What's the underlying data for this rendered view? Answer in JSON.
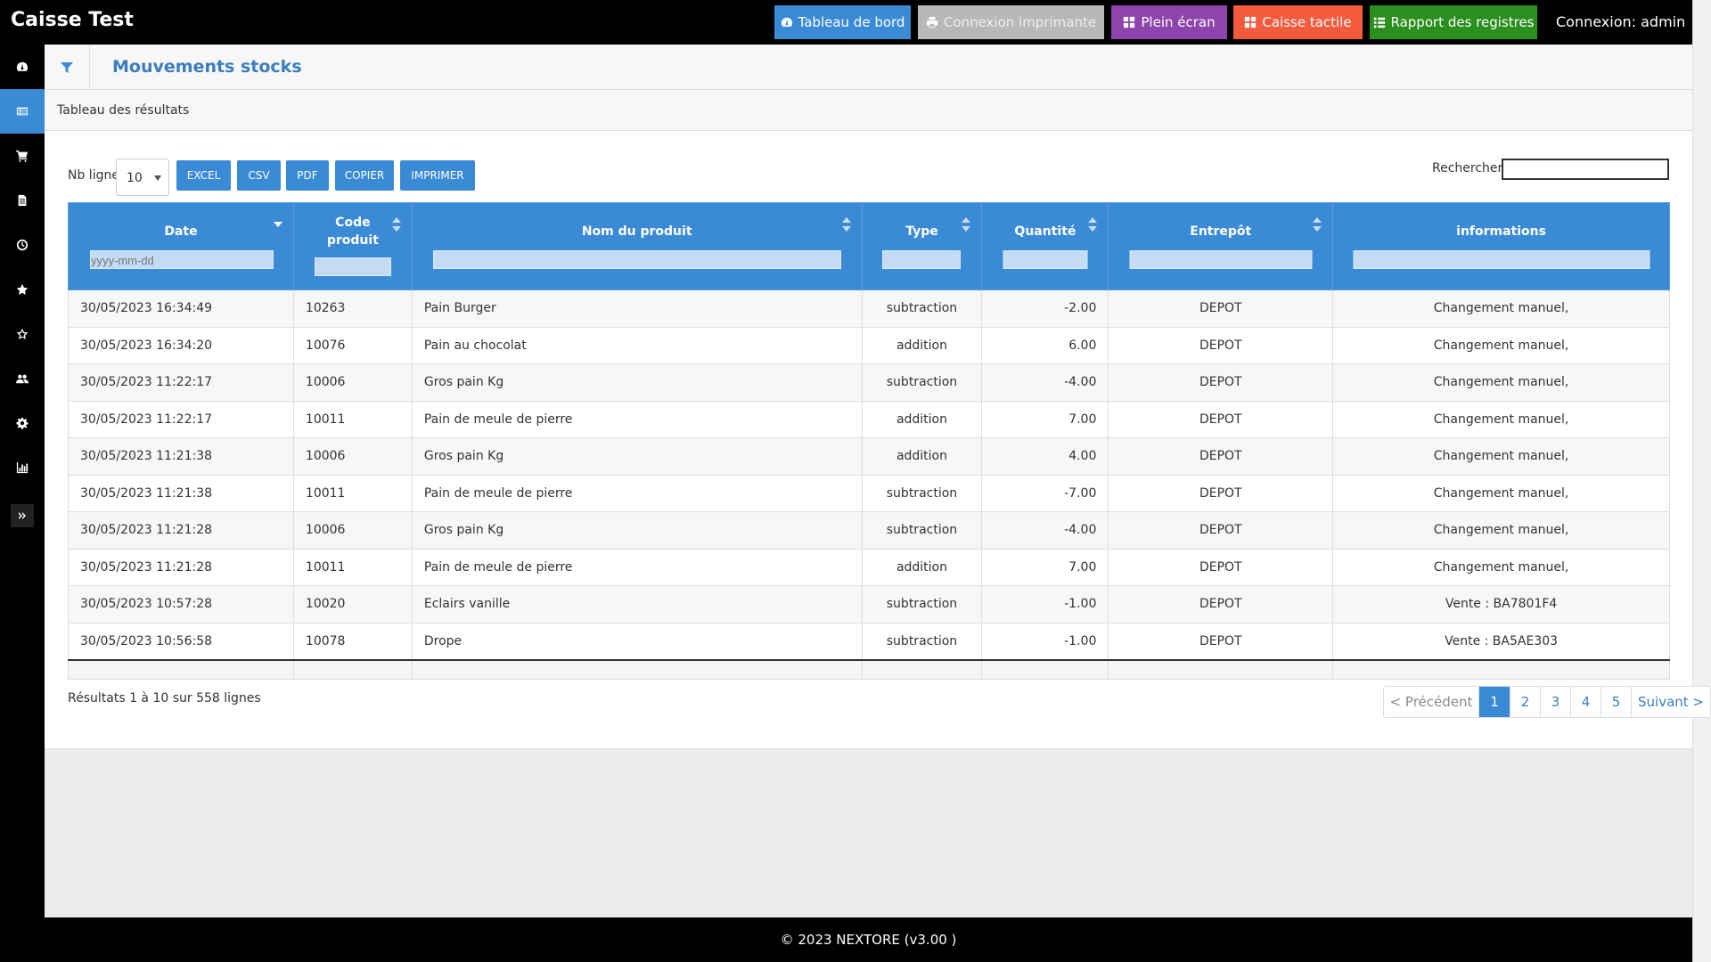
{
  "app": {
    "title": "Caisse Test",
    "login_text": "Connexion: admin"
  },
  "topbar": {
    "dashboard": "Tableau de bord",
    "printer": "Connexion imprimante",
    "fullscreen": "Plein écran",
    "touch": "Caisse tactile",
    "report": "Rapport des registres"
  },
  "colors": {
    "accent": "#3a8ad6",
    "fullscreen": "#8e44ad",
    "touch": "#f25b3c",
    "report": "#2b8f1e",
    "printer": "#b8b8b8"
  },
  "sidebar": {
    "items": [
      "dashboard-icon",
      "table-icon",
      "cart-icon",
      "document-icon",
      "clock-icon",
      "star-icon",
      "star-outline-icon",
      "users-icon",
      "gear-icon",
      "chart-icon"
    ],
    "active_index": 1
  },
  "page": {
    "title": "Mouvements stocks",
    "subtitle": "Tableau des résultats"
  },
  "controls": {
    "nb_line_label": "Nb ligne",
    "nb_line_value": "10",
    "buttons": [
      "EXCEL",
      "CSV",
      "PDF",
      "COPIER",
      "IMPRIMER"
    ],
    "search_label": "Rechercher"
  },
  "table": {
    "headers": [
      "Date",
      "Code produit",
      "Nom du produit",
      "Type",
      "Quantité",
      "Entrepôt",
      "informations"
    ],
    "date_filter_placeholder": "yyyy-mm-dd",
    "rows": [
      [
        "30/05/2023 16:34:49",
        "10263",
        "Pain Burger",
        "subtraction",
        "-2.00",
        "DEPOT",
        "Changement manuel,"
      ],
      [
        "30/05/2023 16:34:20",
        "10076",
        "Pain au chocolat",
        "addition",
        "6.00",
        "DEPOT",
        "Changement manuel,"
      ],
      [
        "30/05/2023 11:22:17",
        "10006",
        "Gros pain Kg",
        "subtraction",
        "-4.00",
        "DEPOT",
        "Changement manuel,"
      ],
      [
        "30/05/2023 11:22:17",
        "10011",
        "Pain de meule de pierre",
        "addition",
        "7.00",
        "DEPOT",
        "Changement manuel,"
      ],
      [
        "30/05/2023 11:21:38",
        "10006",
        "Gros pain Kg",
        "addition",
        "4.00",
        "DEPOT",
        "Changement manuel,"
      ],
      [
        "30/05/2023 11:21:38",
        "10011",
        "Pain de meule de pierre",
        "subtraction",
        "-7.00",
        "DEPOT",
        "Changement manuel,"
      ],
      [
        "30/05/2023 11:21:28",
        "10006",
        "Gros pain Kg",
        "subtraction",
        "-4.00",
        "DEPOT",
        "Changement manuel,"
      ],
      [
        "30/05/2023 11:21:28",
        "10011",
        "Pain de meule de pierre",
        "addition",
        "7.00",
        "DEPOT",
        "Changement manuel,"
      ],
      [
        "30/05/2023 10:57:28",
        "10020",
        "Eclairs vanille",
        "subtraction",
        "-1.00",
        "DEPOT",
        "Vente : BA7801F4"
      ],
      [
        "30/05/2023 10:56:58",
        "10078",
        "Drope",
        "subtraction",
        "-1.00",
        "DEPOT",
        "Vente : BA5AE303"
      ]
    ]
  },
  "results": {
    "info": "Résultats 1 à 10 sur 558 lignes"
  },
  "pagination": {
    "prev": "< Précédent",
    "pages": [
      "1",
      "2",
      "3",
      "4",
      "5"
    ],
    "next": "Suivant >",
    "active": "1"
  },
  "footer": {
    "text": "© 2023 NEXTORE (v3.00 )"
  }
}
